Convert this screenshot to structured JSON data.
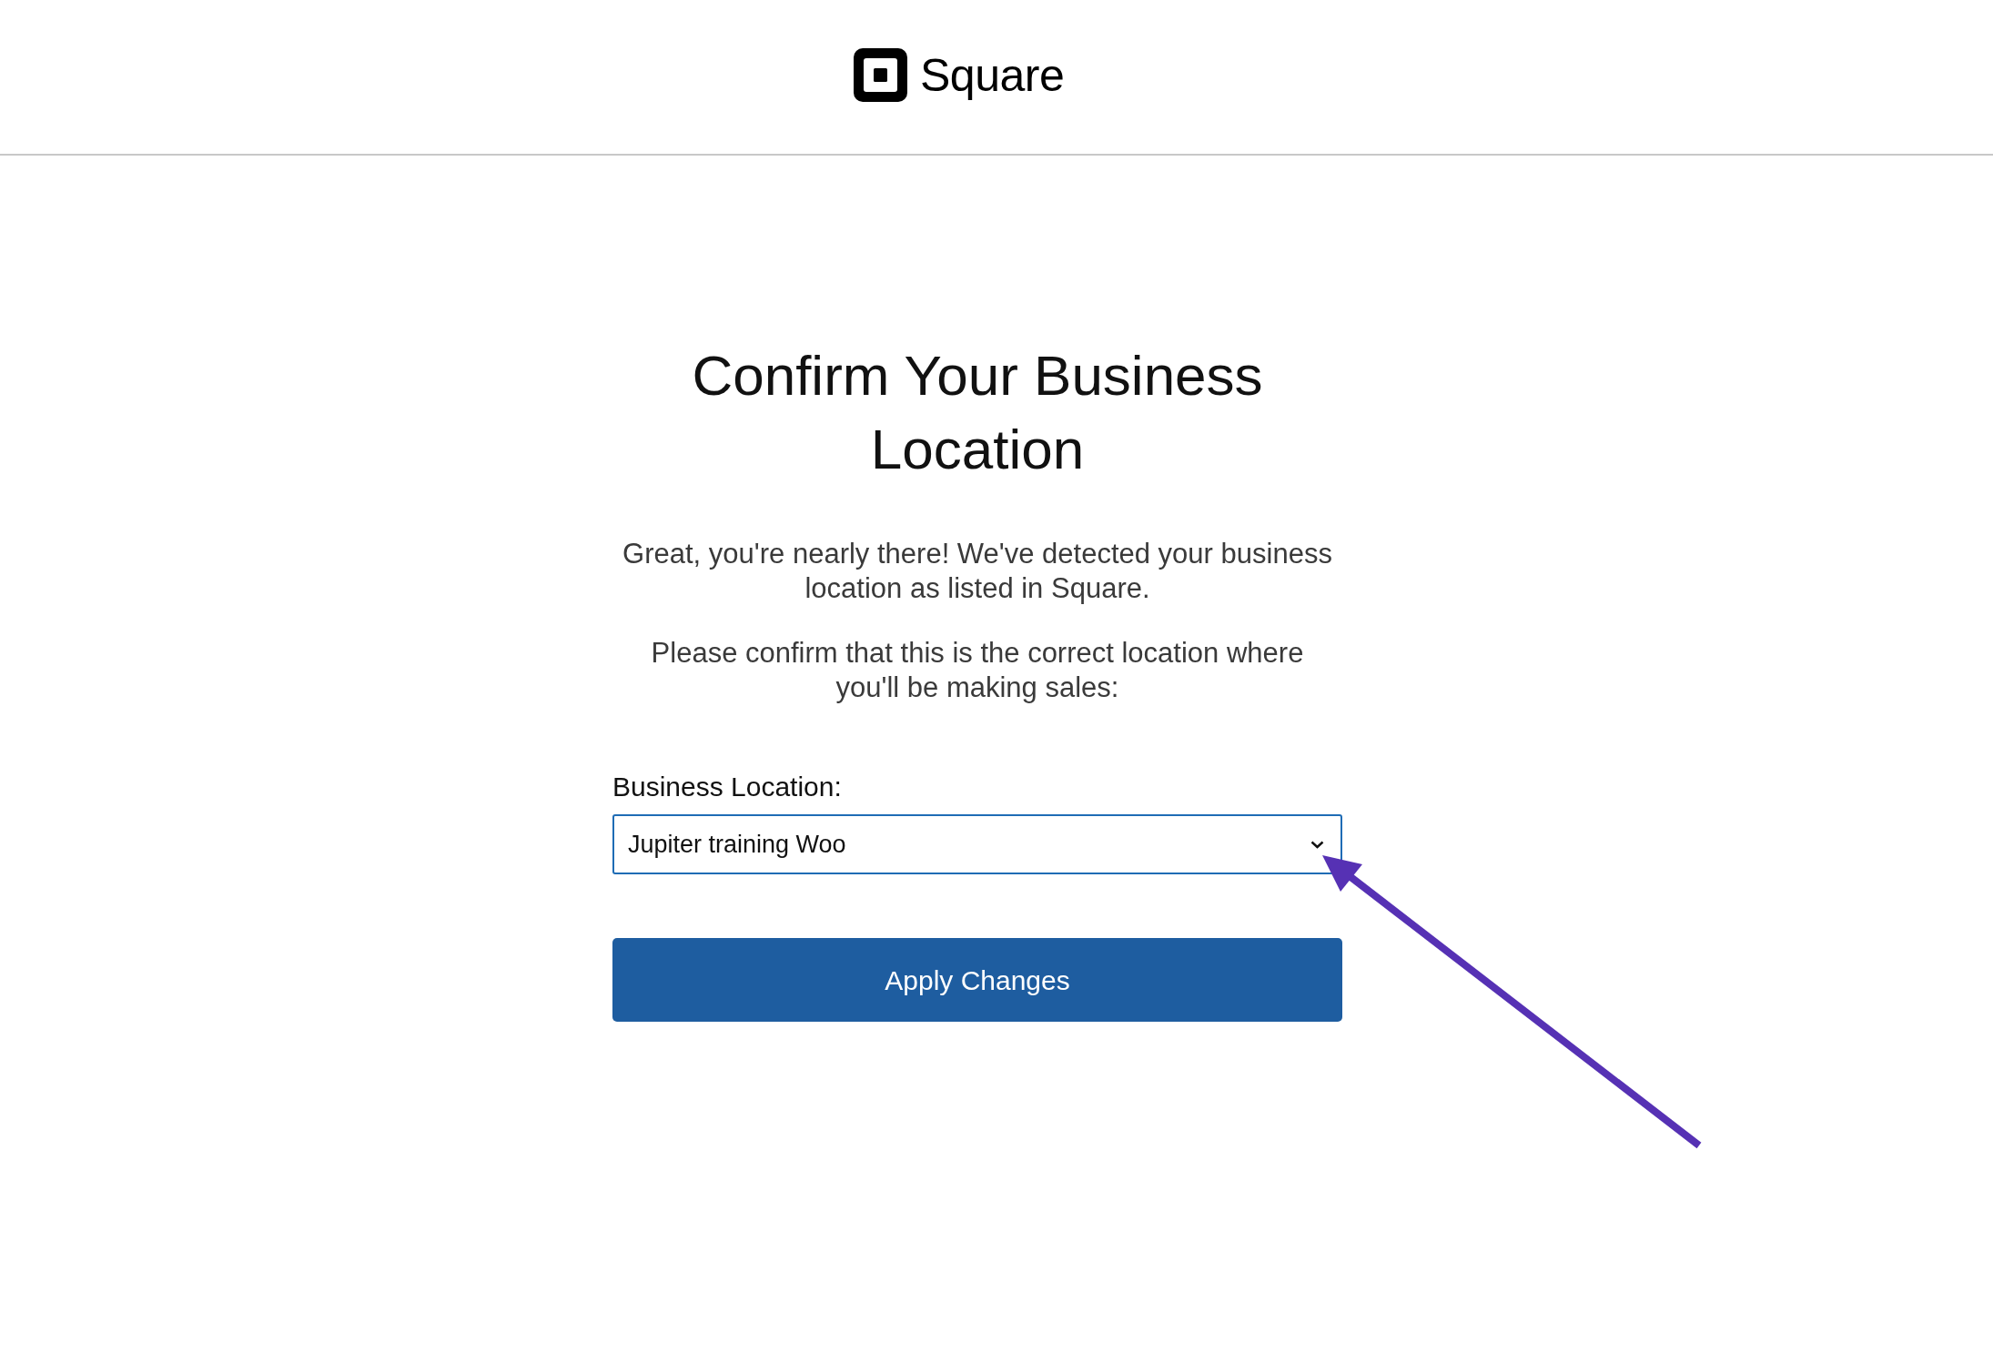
{
  "header": {
    "logo_text": "Square"
  },
  "title": "Confirm Your Business Location",
  "paragraphs": [
    "Great, you're nearly there! We've detected your business location as listed in Square.",
    "Please confirm that this is the correct location where you'll be making sales:"
  ],
  "location_field": {
    "label": "Business Location:",
    "value": "Jupiter training Woo"
  },
  "submit_button": {
    "label": "Apply Changes"
  }
}
